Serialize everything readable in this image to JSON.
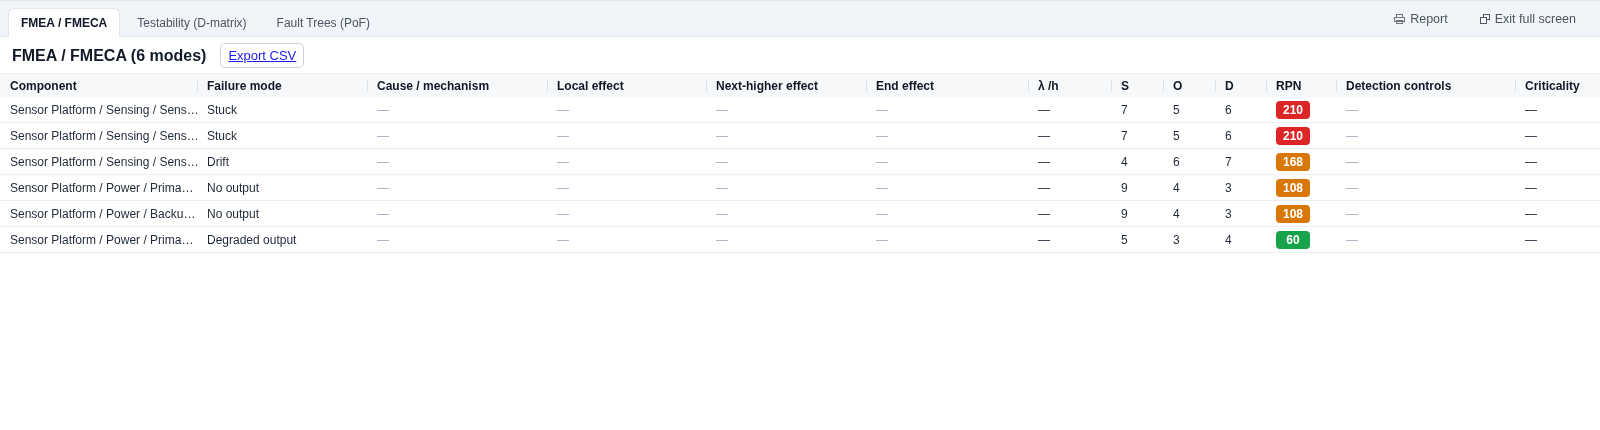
{
  "tabs": [
    {
      "label": "FMEA / FMECA",
      "selected": true
    },
    {
      "label": "Testability (D-matrix)",
      "selected": false
    },
    {
      "label": "Fault Trees (PoF)",
      "selected": false
    }
  ],
  "actions": [
    {
      "label": "Report",
      "kind": "report"
    },
    {
      "label": "Exit full screen",
      "kind": "exit"
    }
  ],
  "heading": "FMEA / FMECA (6 modes)",
  "export_button": "Export CSV",
  "table": {
    "columns": [
      "Component",
      "Failure mode",
      "Cause / mechanism",
      "Local effect",
      "Next-higher effect",
      "End effect",
      "λ /h",
      "S",
      "O",
      "D",
      "RPN",
      "Detection controls",
      "Criticality"
    ],
    "rows": [
      {
        "cells": [
          "Sensor Platform / Sensing / Sens…",
          "Stuck",
          "—",
          "—",
          "—",
          "—",
          "—",
          "7",
          "5",
          "6",
          "210",
          "—",
          "—"
        ],
        "color": "#dc2626"
      },
      {
        "cells": [
          "Sensor Platform / Sensing / Sens…",
          "Stuck",
          "—",
          "—",
          "—",
          "—",
          "—",
          "7",
          "5",
          "6",
          "210",
          "—",
          "—"
        ],
        "color": "#dc2626"
      },
      {
        "cells": [
          "Sensor Platform / Sensing / Sens…",
          "Drift",
          "—",
          "—",
          "—",
          "—",
          "—",
          "4",
          "6",
          "7",
          "168",
          "—",
          "—"
        ],
        "color": "#d97706"
      },
      {
        "cells": [
          "Sensor Platform / Power / Prima…",
          "No output",
          "—",
          "—",
          "—",
          "—",
          "—",
          "9",
          "4",
          "3",
          "108",
          "—",
          "—"
        ],
        "color": "#d97706"
      },
      {
        "cells": [
          "Sensor Platform / Power / Backu…",
          "No output",
          "—",
          "—",
          "—",
          "—",
          "—",
          "9",
          "4",
          "3",
          "108",
          "—",
          "—"
        ],
        "color": "#d97706"
      },
      {
        "cells": [
          "Sensor Platform / Power / Prima…",
          "Degraded output",
          "—",
          "—",
          "—",
          "—",
          "—",
          "5",
          "3",
          "4",
          "60",
          "—",
          "—"
        ],
        "color": "#16a34a"
      }
    ]
  }
}
